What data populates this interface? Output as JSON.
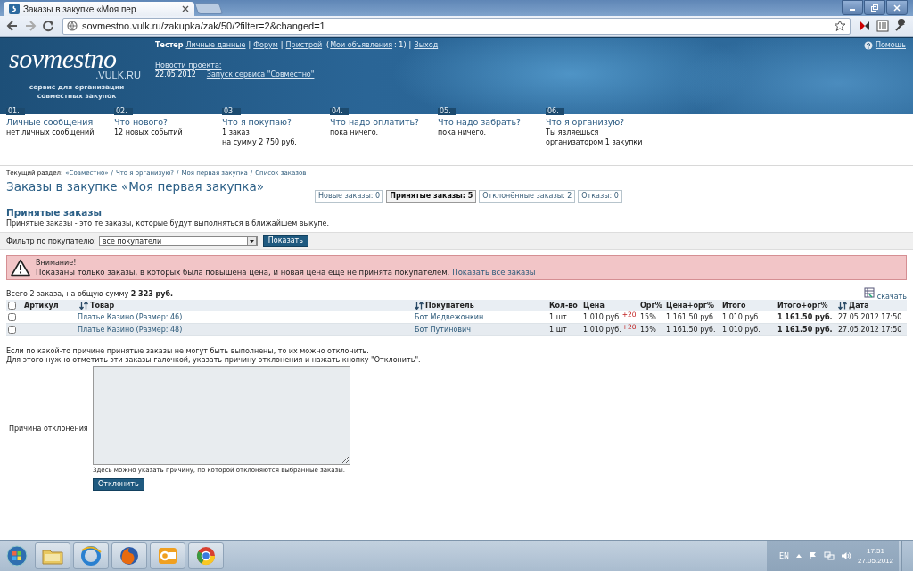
{
  "browser": {
    "tab_title": "Заказы в закупке «Моя пер",
    "url": "sovmestno.vulk.ru/zakupka/zak/50/?filter=2&changed=1"
  },
  "header": {
    "logo": "sovmestno",
    "logo_domain": ".VULK.RU",
    "tagline": "сервис для организации совместных закупок",
    "user_bar": [
      {
        "kind": "name",
        "text": "Тестер"
      },
      {
        "kind": "link",
        "text": "Личные данные"
      },
      {
        "kind": "sep",
        "text": "|"
      },
      {
        "kind": "link",
        "text": "Форум"
      },
      {
        "kind": "sep",
        "text": "|"
      },
      {
        "kind": "link",
        "text": "Пристрой"
      },
      {
        "kind": "text",
        "text": "("
      },
      {
        "kind": "link",
        "text": "Мои объявления"
      },
      {
        "kind": "text",
        "text": ": 1)"
      },
      {
        "kind": "sep",
        "text": "|"
      },
      {
        "kind": "link",
        "text": "Выход"
      }
    ],
    "help": "Помощь",
    "news": {
      "label": "Новости проекта:",
      "date": "22.05.2012",
      "link": "Запуск сервиса \"Совместно\""
    }
  },
  "nav": [
    {
      "number": "01.",
      "title": "Личные сообщения",
      "lines": [
        "нет личных сообщений"
      ]
    },
    {
      "number": "02.",
      "title": "Что нового?",
      "lines": [
        "12 новых событий"
      ]
    },
    {
      "number": "03.",
      "title": "Что я покупаю?",
      "lines": [
        "1 заказ",
        "на сумму 2 750 руб."
      ]
    },
    {
      "number": "04.",
      "title": "Что надо оплатить?",
      "lines": [
        "пока ничего."
      ]
    },
    {
      "number": "05.",
      "title": "Что надо забрать?",
      "lines": [
        "пока ничего."
      ]
    },
    {
      "number": "06.",
      "title": "Что я организую?",
      "lines": [
        "Ты являешься",
        "организатором 1 закупки"
      ]
    }
  ],
  "breadcrumb": {
    "label": "Текущий раздел:",
    "separator": "/",
    "items": [
      "«Совместно»",
      "Что я организую?",
      "Моя первая закупка",
      "Список заказов"
    ]
  },
  "title": "Заказы в закупке «Моя первая закупка»",
  "tabs": [
    {
      "label": "Новые заказы: 0",
      "selected": false
    },
    {
      "label": "Принятые заказы: 5",
      "selected": true
    },
    {
      "label": "Отклонённые заказы: 2",
      "selected": false
    },
    {
      "label": "Отказы: 0",
      "selected": false
    }
  ],
  "section": {
    "heading": "Принятые заказы",
    "description": "Принятые заказы - это те заказы, которые будут выполняться в ближайшем выкупе."
  },
  "filter": {
    "label": "Фильтр по покупателю:",
    "value": "все покупатели",
    "button": "Показать"
  },
  "alert": {
    "title": "Внимание!",
    "text": "Показаны только заказы, в которых была повышена цена, и новая цена ещё не принята покупателем.",
    "link": "Показать все заказы"
  },
  "summary": "Всего 2 заказа, на общую сумму **2 323 руб.**",
  "download": "скачать",
  "table": {
    "columns": [
      {
        "kind": "checkbox",
        "checked": false
      },
      {
        "kind": "text",
        "label": "Артикул",
        "sortable": false
      },
      {
        "kind": "text",
        "label": "Товар",
        "sortable": true
      },
      {
        "kind": "text",
        "label": "Покупатель",
        "sortable": true
      },
      {
        "kind": "text",
        "label": "Кол-во",
        "sortable": false
      },
      {
        "kind": "text",
        "label": "Цена",
        "sortable": false
      },
      {
        "kind": "text",
        "label": "Орг%",
        "sortable": false
      },
      {
        "kind": "text",
        "label": "Цена+орг%",
        "sortable": false
      },
      {
        "kind": "text",
        "label": "Итого",
        "sortable": false
      },
      {
        "kind": "text",
        "label": "Итого+орг%",
        "sortable": false
      },
      {
        "kind": "text",
        "label": "Дата",
        "sortable": true
      }
    ],
    "rows": [
      {
        "checked": false,
        "product": "Платье Казино (Размер: 46)",
        "buyer": "Бот Медвежонкин",
        "quantity": "1 шт",
        "price": "1 010 руб.",
        "price_change": "+20",
        "org_percent": "15%",
        "price_with_org": "1 161.50 руб.",
        "total": "1 010 руб.",
        "total_with_org": "1 161.50 руб.",
        "date": "27.05.2012 17:50"
      },
      {
        "checked": false,
        "product": "Платье Казино (Размер: 48)",
        "buyer": "Бот Путинович",
        "quantity": "1 шт",
        "price": "1 010 руб.",
        "price_change": "+20",
        "org_percent": "15%",
        "price_with_org": "1 161.50 руб.",
        "total": "1 010 руб.",
        "total_with_org": "1 161.50 руб.",
        "date": "27.05.2012 17:50"
      }
    ]
  },
  "reject": {
    "notes": [
      "Если по какой-то причине принятые заказы не могут быть выполнены, то их можно отклонить.",
      "Для этого нужно отметить эти заказы галочкой, указать причину отклонения и нажать кнопку \"Отклонить\"."
    ],
    "label": "Причина отклонения",
    "hint": "Здесь можно указать причину, по которой отклоняются выбранные заказы.",
    "button": "Отклонить"
  },
  "taskbar": {
    "language": "EN",
    "time": "17:51",
    "date": "27.05.2012"
  }
}
